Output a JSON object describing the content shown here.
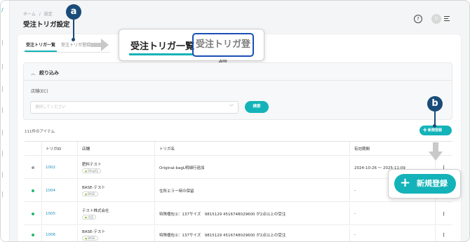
{
  "breadcrumb": {
    "home": "ホーム",
    "separator": "/",
    "current": "設定"
  },
  "page_title": "受注トリガ設定",
  "header": {
    "help_glyph": "?",
    "user_initial": "U"
  },
  "tabs": {
    "active": "受注トリガ一覧",
    "inactive": "受注トリガ登録"
  },
  "zoom_tabs": {
    "active": "受注トリガ一覧",
    "inactive": "受注トリガ登録"
  },
  "badges": {
    "a": "a",
    "b": "b"
  },
  "filter": {
    "title": "絞り込み",
    "store_label": "店舗(EC)",
    "store_placeholder": "選択してください",
    "search_label": "検索"
  },
  "item_count": "111件のアイテム",
  "new_button": "新規登録",
  "zoom_new_button": "新規登録",
  "table": {
    "headers": [
      "",
      "トリガID",
      "店舗",
      "トリガ名",
      "有効期間",
      ""
    ],
    "rows": [
      {
        "status_color": "#9e9e9e",
        "id": "1002",
        "store": "肥料テスト",
        "platform": "Shopify",
        "name": "Original-bagL明細行追加",
        "period": "2024-10-26 〜 2025-11-09"
      },
      {
        "status_color": "#21b573",
        "id": "1004",
        "store": "BASE-テスト",
        "platform": "BASE",
        "name": "住所エラー時の保留",
        "period": "-"
      },
      {
        "status_color": "#21b573",
        "id": "1005",
        "store": "テスト株式会社",
        "platform": "大田",
        "name": "特殊梱包②：137サイズ　9815129 4516748029600 が2点以上の受注",
        "period": "-"
      },
      {
        "status_color": "#21b573",
        "id": "1006",
        "store": "BASE-テスト",
        "platform": "BASE",
        "name": "特殊梱包②：137サイズ　9815129 4516748029600 が2点以上の受注",
        "period": "-"
      }
    ]
  },
  "rail_icons": [
    "home-icon",
    "order-icon",
    "shipping-icon",
    "stock-icon",
    "product-icon",
    "setting-icon"
  ]
}
